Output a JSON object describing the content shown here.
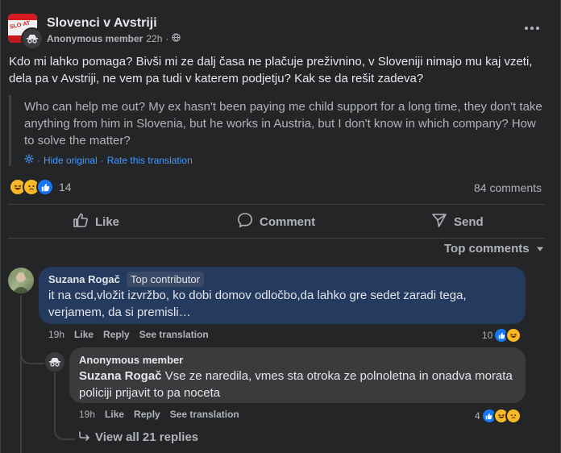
{
  "post": {
    "group_name": "Slovenci v Avstriji",
    "author": "Anonymous member",
    "time": "22h",
    "text": "Kdo mi lahko pomaga? Bivši mi ze dalj časa ne plačuje preživnino, v Sloveniji nimajo mu kaj vzeti, dela pa v Avstriji, ne vem pa tudi v katerem podjetju? Kak se da rešit zadeva?",
    "translation": "Who can help me out? My ex hasn't been paying me child support for a long time, they don't take anything from him in Slovenia, but he works in Austria, but I don't know in which company? How to solve the matter?",
    "hide_original": "Hide original",
    "separator": "·",
    "rate_translation": "Rate this translation",
    "reaction_count": "14",
    "comments_count": "84 comments"
  },
  "actions": {
    "like": "Like",
    "comment": "Comment",
    "send": "Send"
  },
  "sort": {
    "label": "Top comments"
  },
  "comments": [
    {
      "author": "Suzana Rogač",
      "badge": "Top contributor",
      "text": "it na csd,vložit izvržbo, ko dobi domov odločbo,da lahko gre sedet zaradi tega, verjamem, da si premisli…",
      "time": "19h",
      "like": "Like",
      "reply": "Reply",
      "see_translation": "See translation",
      "reaction_count": "10"
    },
    {
      "author": "Anonymous member",
      "mention": "Suzana Rogač",
      "text": "Vse ze naredila, vmes sta otroka ze polnoletna in onadva morata policiji prijavit to pa noceta",
      "time": "19h",
      "like": "Like",
      "reply": "Reply",
      "see_translation": "See translation",
      "reaction_count": "4"
    }
  ],
  "view_replies": "View all 21 replies",
  "icons": [
    "group-logo",
    "anonymous-icon",
    "globe-icon",
    "more-icon",
    "translate-gear-icon",
    "haha-reaction-icon",
    "sad-reaction-icon",
    "like-reaction-icon",
    "like-icon",
    "comment-icon",
    "send-icon",
    "chevron-down-icon",
    "reply-arrow-icon"
  ],
  "colors": {
    "background": "#242526",
    "link": "#4599ff",
    "like_blue": "#1877f2",
    "highlight_bubble": "#243a5e"
  }
}
